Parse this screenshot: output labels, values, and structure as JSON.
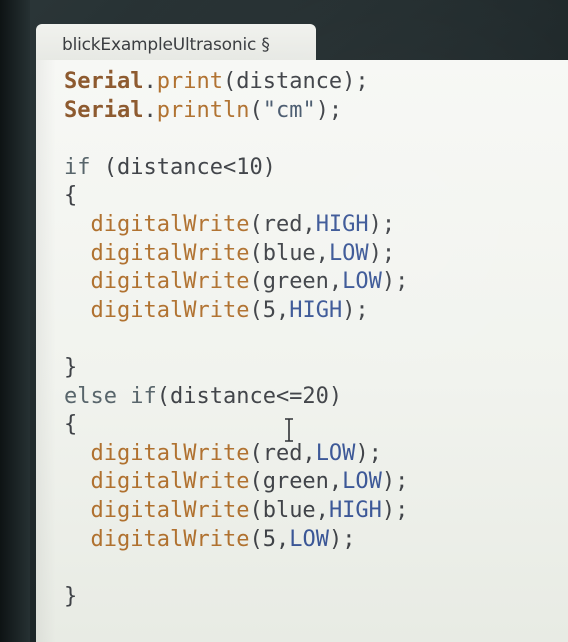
{
  "tab": {
    "label": "blickExampleUltrasonic §"
  },
  "code": {
    "lines": [
      [
        {
          "t": "Serial",
          "c": "serial"
        },
        {
          "t": ".",
          "c": "plain"
        },
        {
          "t": "print",
          "c": "fn"
        },
        {
          "t": "(distance);",
          "c": "plain"
        }
      ],
      [
        {
          "t": "Serial",
          "c": "serial"
        },
        {
          "t": ".",
          "c": "plain"
        },
        {
          "t": "println",
          "c": "fn"
        },
        {
          "t": "(",
          "c": "plain"
        },
        {
          "t": "\"cm\"",
          "c": "str"
        },
        {
          "t": ");",
          "c": "plain"
        }
      ],
      [],
      [
        {
          "t": "if",
          "c": "kw"
        },
        {
          "t": " (distance<10)",
          "c": "plain"
        }
      ],
      [
        {
          "t": "{",
          "c": "plain"
        }
      ],
      [
        {
          "t": "  ",
          "c": "plain"
        },
        {
          "t": "digitalWrite",
          "c": "fn"
        },
        {
          "t": "(red,",
          "c": "plain"
        },
        {
          "t": "HIGH",
          "c": "const"
        },
        {
          "t": ");",
          "c": "plain"
        }
      ],
      [
        {
          "t": "  ",
          "c": "plain"
        },
        {
          "t": "digitalWrite",
          "c": "fn"
        },
        {
          "t": "(blue,",
          "c": "plain"
        },
        {
          "t": "LOW",
          "c": "const"
        },
        {
          "t": ");",
          "c": "plain"
        }
      ],
      [
        {
          "t": "  ",
          "c": "plain"
        },
        {
          "t": "digitalWrite",
          "c": "fn"
        },
        {
          "t": "(green,",
          "c": "plain"
        },
        {
          "t": "LOW",
          "c": "const"
        },
        {
          "t": ");",
          "c": "plain"
        }
      ],
      [
        {
          "t": "  ",
          "c": "plain"
        },
        {
          "t": "digitalWrite",
          "c": "fn"
        },
        {
          "t": "(5,",
          "c": "plain"
        },
        {
          "t": "HIGH",
          "c": "const"
        },
        {
          "t": ");",
          "c": "plain"
        }
      ],
      [],
      [
        {
          "t": "}",
          "c": "plain"
        }
      ],
      [
        {
          "t": "else",
          "c": "kw"
        },
        {
          "t": " ",
          "c": "plain"
        },
        {
          "t": "if",
          "c": "kw"
        },
        {
          "t": "(distance<=20)",
          "c": "plain"
        }
      ],
      [
        {
          "t": "{",
          "c": "plain"
        }
      ],
      [
        {
          "t": "  ",
          "c": "plain"
        },
        {
          "t": "digitalWrite",
          "c": "fn"
        },
        {
          "t": "(red,",
          "c": "plain"
        },
        {
          "t": "LOW",
          "c": "const"
        },
        {
          "t": ");",
          "c": "plain"
        }
      ],
      [
        {
          "t": "  ",
          "c": "plain"
        },
        {
          "t": "digitalWrite",
          "c": "fn"
        },
        {
          "t": "(green,",
          "c": "plain"
        },
        {
          "t": "LOW",
          "c": "const"
        },
        {
          "t": ");",
          "c": "plain"
        }
      ],
      [
        {
          "t": "  ",
          "c": "plain"
        },
        {
          "t": "digitalWrite",
          "c": "fn"
        },
        {
          "t": "(blue,",
          "c": "plain"
        },
        {
          "t": "HIGH",
          "c": "const"
        },
        {
          "t": ");",
          "c": "plain"
        }
      ],
      [
        {
          "t": "  ",
          "c": "plain"
        },
        {
          "t": "digitalWrite",
          "c": "fn"
        },
        {
          "t": "(5,",
          "c": "plain"
        },
        {
          "t": "LOW",
          "c": "const"
        },
        {
          "t": ");",
          "c": "plain"
        }
      ],
      [],
      [
        {
          "t": "}",
          "c": "plain"
        }
      ]
    ]
  },
  "cursor": {
    "icon": "text-cursor-icon"
  },
  "colors": {
    "serial": "#8d5a2f",
    "function": "#b0712f",
    "keyword": "#58656b",
    "constant": "#3a5696",
    "editor_bg": "#f3f5f0",
    "tab_bg": "#eceee9"
  }
}
